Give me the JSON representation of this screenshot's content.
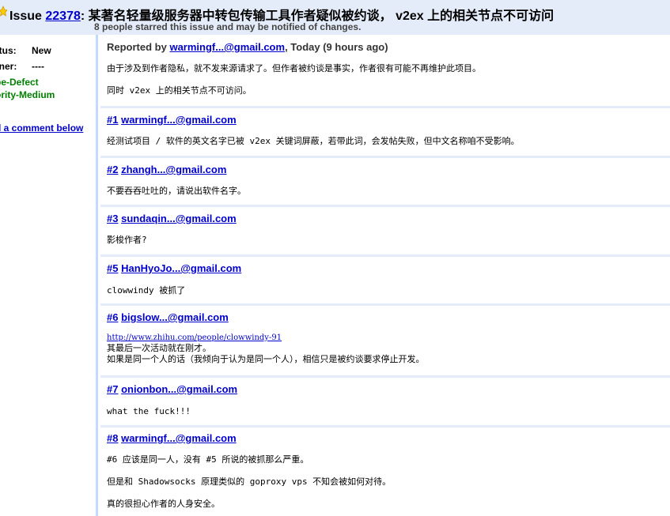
{
  "header": {
    "issue_label": "Issue",
    "issue_number": "22378",
    "issue_sep": ":",
    "title": "某著名轻量级服务器中转包传输工具作者疑似被约谈， v2ex 上的相关节点不可访问",
    "starred_note": "8 people starred this issue and may be notified of changes."
  },
  "sidebar": {
    "status_key": "atus:",
    "status_value": "New",
    "owner_key": "vner:",
    "owner_value": "----",
    "labels": [
      "pe-Defect",
      "ority-Medium"
    ],
    "add_comment": "d a comment below"
  },
  "report": {
    "prefix": "Reported by",
    "author": "warmingf...@gmail.com",
    "time": ", Today (9 hours ago)",
    "lines": [
      "由于涉及到作者隐私，就不发来源请求了。但作者被约谈是事实，作者很有可能不再维护此项目。",
      "同时 v2ex 上的相关节点不可访问。"
    ]
  },
  "comments": [
    {
      "num": "#1",
      "author": "warmingf...@gmail.com",
      "lines": [
        "经测试项目 / 软件的英文名字已被 v2ex 关键词屏蔽，若带此词，会发帖失败，但中文名称咱不受影响。"
      ]
    },
    {
      "num": "#2",
      "author": "zhangh...@gmail.com",
      "lines": [
        "不要吞吞吐吐的，请说出软件名字。"
      ]
    },
    {
      "num": "#3",
      "author": "sundaqin...@gmail.com",
      "lines": [
        "影梭作者?"
      ]
    },
    {
      "num": "#5",
      "author": "HanHyoJo...@gmail.com",
      "lines": [
        "clowwindy 被抓了"
      ]
    },
    {
      "num": "#6",
      "author": "bigslow...@gmail.com",
      "link": "http://www.zhihu.com/people/clowwindy-91",
      "lines": [
        "其最后一次活动就在刚才。",
        "如果是同一个人的话（我倾向于认为是同一个人），相信只是被约谈要求停止开发。"
      ]
    },
    {
      "num": "#7",
      "author": "onionbon...@gmail.com",
      "lines": [
        "what the fuck!!!"
      ]
    },
    {
      "num": "#8",
      "author": "warmingf...@gmail.com",
      "lines": [
        "#6 应该是同一人，没有 #5 所说的被抓那么严重。",
        "但是和 Shadowsocks 原理类似的 goproxy vps 不知会被如何对待。",
        "真的很担心作者的人身安全。"
      ]
    }
  ],
  "colors": {
    "header_bg": "#e5ecf9",
    "link": "#0000cc",
    "label_green": "#008000",
    "divider": "#e5ecf9",
    "sidebar_border": "#c3d9ff"
  }
}
